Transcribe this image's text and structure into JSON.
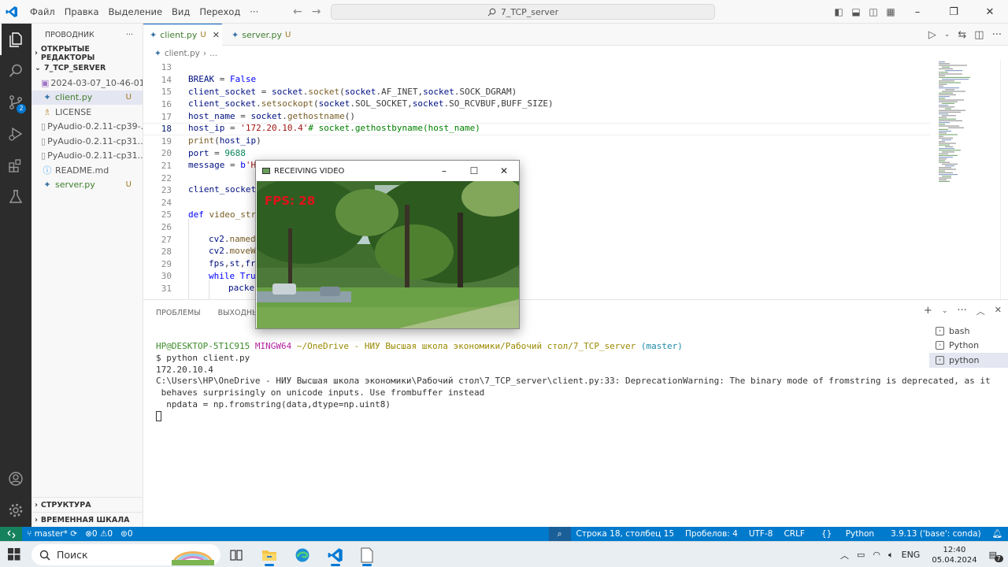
{
  "titlebar": {
    "menu": [
      "Файл",
      "Правка",
      "Выделение",
      "Вид",
      "Переход",
      "···"
    ],
    "search": "7_TCP_server",
    "window_controls": [
      "–",
      "❐",
      "✕"
    ]
  },
  "sidebar": {
    "header": "ПРОВОДНИК",
    "header_more": "···",
    "open_editors": "ОТКРЫТЫЕ РЕДАКТОРЫ",
    "project": "7_TCP_SERVER",
    "files": [
      {
        "name": "2024-03-07_10-46-01...",
        "status": "",
        "icon": "image-icon"
      },
      {
        "name": "client.py",
        "status": "U",
        "icon": "python-icon"
      },
      {
        "name": "LICENSE",
        "status": "",
        "icon": "license-icon"
      },
      {
        "name": "PyAudio-0.2.11-cp39-...",
        "status": "",
        "icon": "file-icon"
      },
      {
        "name": "PyAudio-0.2.11-cp31...",
        "status": "",
        "icon": "file-icon"
      },
      {
        "name": "PyAudio-0.2.11-cp31...",
        "status": "",
        "icon": "file-icon"
      },
      {
        "name": "README.md",
        "status": "",
        "icon": "info-icon"
      },
      {
        "name": "server.py",
        "status": "U",
        "icon": "python-icon"
      }
    ],
    "outline": "СТРУКТУРА",
    "timeline": "ВРЕМЕННАЯ ШКАЛА",
    "scm_badge": "2"
  },
  "tabs": [
    {
      "name": "client.py",
      "status": "U",
      "close": "✕"
    },
    {
      "name": "server.py",
      "status": "U"
    }
  ],
  "breadcrumb": {
    "file": "client.py",
    "sep": "›",
    "rest": "..."
  },
  "editor": {
    "line_numbers": [
      "13",
      "14",
      "15",
      "16",
      "17",
      "18",
      "19",
      "20",
      "21",
      "22",
      "23",
      "24",
      "25",
      "26",
      "27",
      "28",
      "29",
      "30",
      "31"
    ],
    "current_line": "18"
  },
  "window": {
    "title": "RECEIVING VIDEO",
    "fps_text": "FPS: 28"
  },
  "panel": {
    "tabs": [
      "ПРОБЛЕМЫ",
      "ВЫХОДНЫЕ Д"
    ],
    "terminal": {
      "prompt_user": "HP@DESKTOP-5T1C915",
      "prompt_env": "MINGW64",
      "prompt_path": "~/OneDrive - НИУ Высшая школа экономики/Рабочий стол/7_TCP_server",
      "prompt_branch": "(master)",
      "command": "$ python client.py",
      "output": [
        "172.20.10.4",
        "C:\\Users\\HP\\OneDrive - НИУ Высшая школа экономики\\Рабочий стол\\7_TCP_server\\client.py:33: DeprecationWarning: The binary mode of fromstring is deprecated, as it",
        " behaves surprisingly on unicode inputs. Use frombuffer instead",
        "  npdata = np.fromstring(data,dtype=np.uint8)"
      ]
    },
    "terminals": [
      "bash",
      "Python",
      "python"
    ]
  },
  "statusbar": {
    "branch": "master*",
    "errors": "0",
    "warnings": "0",
    "ports": "0",
    "position": "Строка 18, столбец 15",
    "spaces": "Пробелов: 4",
    "encoding": "UTF-8",
    "eol": "CRLF",
    "language": "Python",
    "interpreter": "3.9.13 ('base': conda)"
  },
  "taskbar": {
    "search": "Поиск",
    "lang": "ENG",
    "time": "12:40",
    "date": "05.04.2024",
    "notif_count": "7"
  },
  "colors": {
    "accent": "#007acc",
    "activity_bar": "#2c2c2c",
    "remote": "#16825d"
  }
}
